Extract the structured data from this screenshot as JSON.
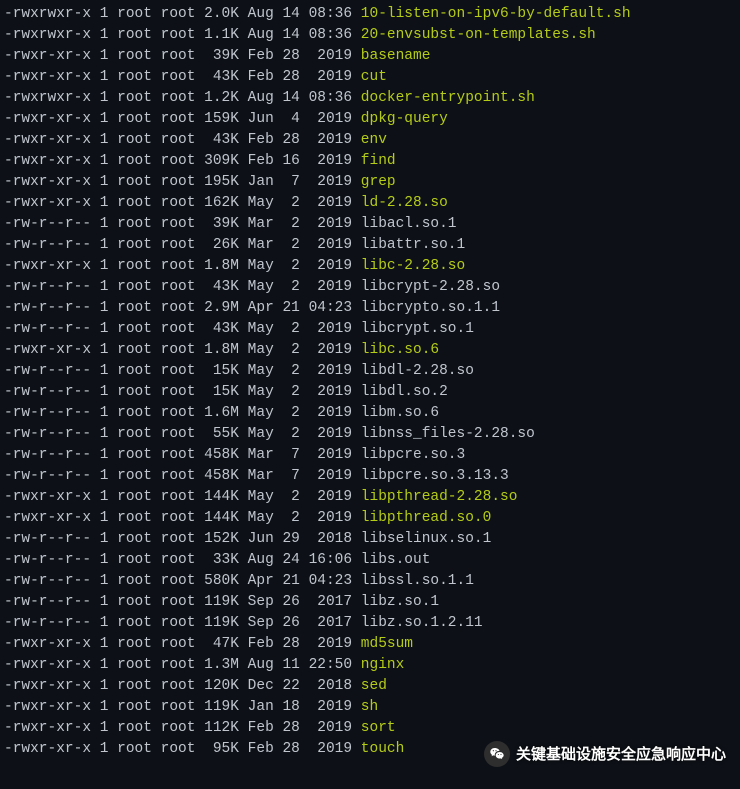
{
  "listing": [
    {
      "perm": "-rwxrwxr-x",
      "links": "1",
      "user": "root",
      "group": "root",
      "size": "2.0K",
      "month": "Aug",
      "day": "14",
      "time": "08:36",
      "name": "10-listen-on-ipv6-by-default.sh",
      "cls": "exec"
    },
    {
      "perm": "-rwxrwxr-x",
      "links": "1",
      "user": "root",
      "group": "root",
      "size": "1.1K",
      "month": "Aug",
      "day": "14",
      "time": "08:36",
      "name": "20-envsubst-on-templates.sh",
      "cls": "exec"
    },
    {
      "perm": "-rwxr-xr-x",
      "links": "1",
      "user": "root",
      "group": "root",
      "size": "39K",
      "month": "Feb",
      "day": "28",
      "time": "2019",
      "name": "basename",
      "cls": "exec"
    },
    {
      "perm": "-rwxr-xr-x",
      "links": "1",
      "user": "root",
      "group": "root",
      "size": "43K",
      "month": "Feb",
      "day": "28",
      "time": "2019",
      "name": "cut",
      "cls": "exec"
    },
    {
      "perm": "-rwxrwxr-x",
      "links": "1",
      "user": "root",
      "group": "root",
      "size": "1.2K",
      "month": "Aug",
      "day": "14",
      "time": "08:36",
      "name": "docker-entrypoint.sh",
      "cls": "exec"
    },
    {
      "perm": "-rwxr-xr-x",
      "links": "1",
      "user": "root",
      "group": "root",
      "size": "159K",
      "month": "Jun",
      "day": "4",
      "time": "2019",
      "name": "dpkg-query",
      "cls": "exec"
    },
    {
      "perm": "-rwxr-xr-x",
      "links": "1",
      "user": "root",
      "group": "root",
      "size": "43K",
      "month": "Feb",
      "day": "28",
      "time": "2019",
      "name": "env",
      "cls": "exec"
    },
    {
      "perm": "-rwxr-xr-x",
      "links": "1",
      "user": "root",
      "group": "root",
      "size": "309K",
      "month": "Feb",
      "day": "16",
      "time": "2019",
      "name": "find",
      "cls": "exec"
    },
    {
      "perm": "-rwxr-xr-x",
      "links": "1",
      "user": "root",
      "group": "root",
      "size": "195K",
      "month": "Jan",
      "day": "7",
      "time": "2019",
      "name": "grep",
      "cls": "exec"
    },
    {
      "perm": "-rwxr-xr-x",
      "links": "1",
      "user": "root",
      "group": "root",
      "size": "162K",
      "month": "May",
      "day": "2",
      "time": "2019",
      "name": "ld-2.28.so",
      "cls": "exec"
    },
    {
      "perm": "-rw-r--r--",
      "links": "1",
      "user": "root",
      "group": "root",
      "size": "39K",
      "month": "Mar",
      "day": "2",
      "time": "2019",
      "name": "libacl.so.1",
      "cls": "plain"
    },
    {
      "perm": "-rw-r--r--",
      "links": "1",
      "user": "root",
      "group": "root",
      "size": "26K",
      "month": "Mar",
      "day": "2",
      "time": "2019",
      "name": "libattr.so.1",
      "cls": "plain"
    },
    {
      "perm": "-rwxr-xr-x",
      "links": "1",
      "user": "root",
      "group": "root",
      "size": "1.8M",
      "month": "May",
      "day": "2",
      "time": "2019",
      "name": "libc-2.28.so",
      "cls": "exec"
    },
    {
      "perm": "-rw-r--r--",
      "links": "1",
      "user": "root",
      "group": "root",
      "size": "43K",
      "month": "May",
      "day": "2",
      "time": "2019",
      "name": "libcrypt-2.28.so",
      "cls": "plain"
    },
    {
      "perm": "-rw-r--r--",
      "links": "1",
      "user": "root",
      "group": "root",
      "size": "2.9M",
      "month": "Apr",
      "day": "21",
      "time": "04:23",
      "name": "libcrypto.so.1.1",
      "cls": "plain"
    },
    {
      "perm": "-rw-r--r--",
      "links": "1",
      "user": "root",
      "group": "root",
      "size": "43K",
      "month": "May",
      "day": "2",
      "time": "2019",
      "name": "libcrypt.so.1",
      "cls": "plain"
    },
    {
      "perm": "-rwxr-xr-x",
      "links": "1",
      "user": "root",
      "group": "root",
      "size": "1.8M",
      "month": "May",
      "day": "2",
      "time": "2019",
      "name": "libc.so.6",
      "cls": "exec"
    },
    {
      "perm": "-rw-r--r--",
      "links": "1",
      "user": "root",
      "group": "root",
      "size": "15K",
      "month": "May",
      "day": "2",
      "time": "2019",
      "name": "libdl-2.28.so",
      "cls": "plain"
    },
    {
      "perm": "-rw-r--r--",
      "links": "1",
      "user": "root",
      "group": "root",
      "size": "15K",
      "month": "May",
      "day": "2",
      "time": "2019",
      "name": "libdl.so.2",
      "cls": "plain"
    },
    {
      "perm": "-rw-r--r--",
      "links": "1",
      "user": "root",
      "group": "root",
      "size": "1.6M",
      "month": "May",
      "day": "2",
      "time": "2019",
      "name": "libm.so.6",
      "cls": "plain"
    },
    {
      "perm": "-rw-r--r--",
      "links": "1",
      "user": "root",
      "group": "root",
      "size": "55K",
      "month": "May",
      "day": "2",
      "time": "2019",
      "name": "libnss_files-2.28.so",
      "cls": "plain"
    },
    {
      "perm": "-rw-r--r--",
      "links": "1",
      "user": "root",
      "group": "root",
      "size": "458K",
      "month": "Mar",
      "day": "7",
      "time": "2019",
      "name": "libpcre.so.3",
      "cls": "plain"
    },
    {
      "perm": "-rw-r--r--",
      "links": "1",
      "user": "root",
      "group": "root",
      "size": "458K",
      "month": "Mar",
      "day": "7",
      "time": "2019",
      "name": "libpcre.so.3.13.3",
      "cls": "plain"
    },
    {
      "perm": "-rwxr-xr-x",
      "links": "1",
      "user": "root",
      "group": "root",
      "size": "144K",
      "month": "May",
      "day": "2",
      "time": "2019",
      "name": "libpthread-2.28.so",
      "cls": "exec"
    },
    {
      "perm": "-rwxr-xr-x",
      "links": "1",
      "user": "root",
      "group": "root",
      "size": "144K",
      "month": "May",
      "day": "2",
      "time": "2019",
      "name": "libpthread.so.0",
      "cls": "exec"
    },
    {
      "perm": "-rw-r--r--",
      "links": "1",
      "user": "root",
      "group": "root",
      "size": "152K",
      "month": "Jun",
      "day": "29",
      "time": "2018",
      "name": "libselinux.so.1",
      "cls": "plain"
    },
    {
      "perm": "-rw-r--r--",
      "links": "1",
      "user": "root",
      "group": "root",
      "size": "33K",
      "month": "Aug",
      "day": "24",
      "time": "16:06",
      "name": "libs.out",
      "cls": "plain"
    },
    {
      "perm": "-rw-r--r--",
      "links": "1",
      "user": "root",
      "group": "root",
      "size": "580K",
      "month": "Apr",
      "day": "21",
      "time": "04:23",
      "name": "libssl.so.1.1",
      "cls": "plain"
    },
    {
      "perm": "-rw-r--r--",
      "links": "1",
      "user": "root",
      "group": "root",
      "size": "119K",
      "month": "Sep",
      "day": "26",
      "time": "2017",
      "name": "libz.so.1",
      "cls": "plain"
    },
    {
      "perm": "-rw-r--r--",
      "links": "1",
      "user": "root",
      "group": "root",
      "size": "119K",
      "month": "Sep",
      "day": "26",
      "time": "2017",
      "name": "libz.so.1.2.11",
      "cls": "plain"
    },
    {
      "perm": "-rwxr-xr-x",
      "links": "1",
      "user": "root",
      "group": "root",
      "size": "47K",
      "month": "Feb",
      "day": "28",
      "time": "2019",
      "name": "md5sum",
      "cls": "exec"
    },
    {
      "perm": "-rwxr-xr-x",
      "links": "1",
      "user": "root",
      "group": "root",
      "size": "1.3M",
      "month": "Aug",
      "day": "11",
      "time": "22:50",
      "name": "nginx",
      "cls": "exec"
    },
    {
      "perm": "-rwxr-xr-x",
      "links": "1",
      "user": "root",
      "group": "root",
      "size": "120K",
      "month": "Dec",
      "day": "22",
      "time": "2018",
      "name": "sed",
      "cls": "exec"
    },
    {
      "perm": "-rwxr-xr-x",
      "links": "1",
      "user": "root",
      "group": "root",
      "size": "119K",
      "month": "Jan",
      "day": "18",
      "time": "2019",
      "name": "sh",
      "cls": "exec"
    },
    {
      "perm": "-rwxr-xr-x",
      "links": "1",
      "user": "root",
      "group": "root",
      "size": "112K",
      "month": "Feb",
      "day": "28",
      "time": "2019",
      "name": "sort",
      "cls": "exec"
    },
    {
      "perm": "-rwxr-xr-x",
      "links": "1",
      "user": "root",
      "group": "root",
      "size": "95K",
      "month": "Feb",
      "day": "28",
      "time": "2019",
      "name": "touch",
      "cls": "exec"
    }
  ],
  "overlay": {
    "text": "关键基础设施安全应急响应中心"
  }
}
